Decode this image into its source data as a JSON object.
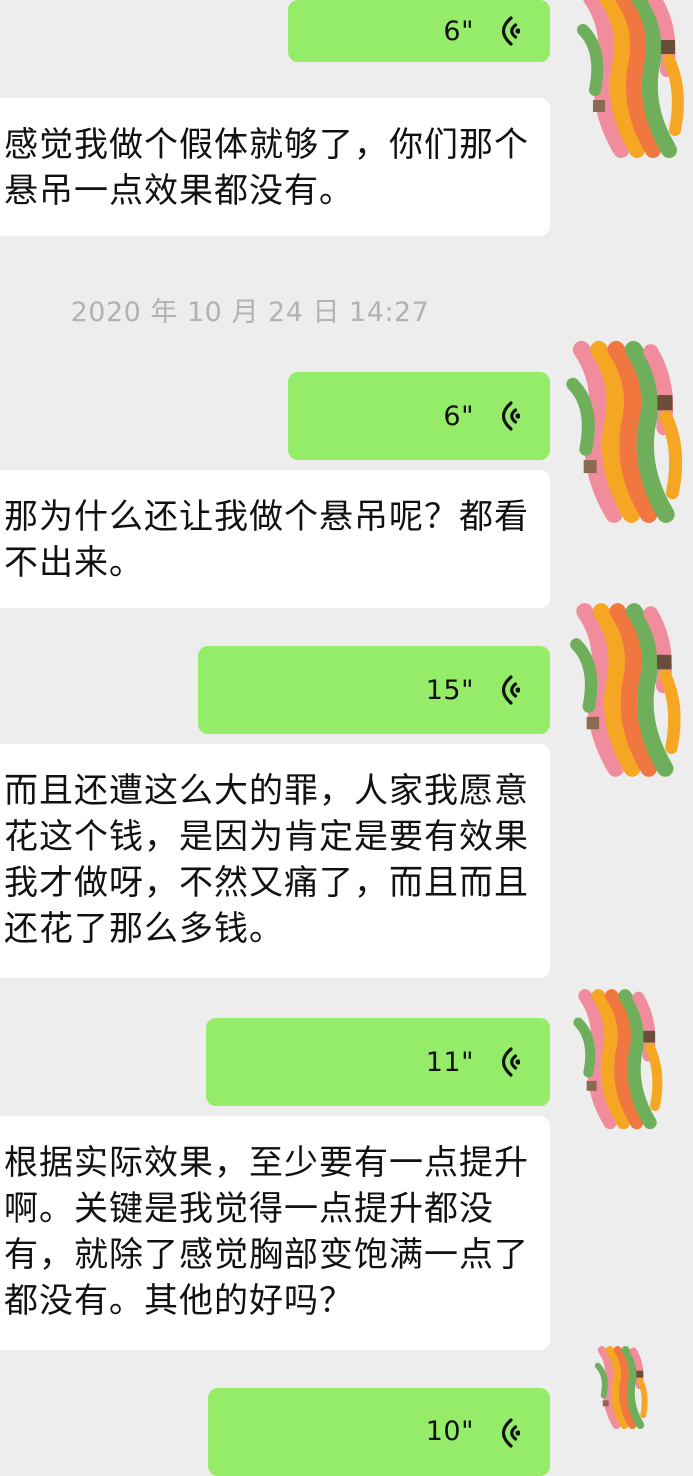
{
  "chat": {
    "timestamp": "2020 年 10 月 24 日 14:27",
    "messages": [
      {
        "type": "voice",
        "side": "right",
        "duration": "6\""
      },
      {
        "type": "text",
        "side": "left",
        "text": "感觉我做个假体就够了，你们那个悬吊一点效果都没有。"
      },
      {
        "type": "voice",
        "side": "right",
        "duration": "6\""
      },
      {
        "type": "text",
        "side": "left",
        "text": "那为什么还让我做个悬吊呢？都看不出来。"
      },
      {
        "type": "voice",
        "side": "right",
        "duration": "15\""
      },
      {
        "type": "text",
        "side": "left",
        "text": "而且还遭这么大的罪，人家我愿意花这个钱，是因为肯定是要有效果我才做呀，不然又痛了，而且而且还花了那么多钱。"
      },
      {
        "type": "voice",
        "side": "right",
        "duration": "11\""
      },
      {
        "type": "text",
        "side": "left",
        "text": "根据实际效果，至少要有一点提升啊。关键是我觉得一点提升都没有，就除了感觉胸部变饱满一点了都没有。其他的好吗？"
      },
      {
        "type": "voice",
        "side": "right",
        "duration": "10\""
      }
    ]
  },
  "colors": {
    "background": "#ededed",
    "voice_bubble": "#95ec69",
    "text_bubble": "#ffffff",
    "timestamp_text": "#b2b2b2"
  },
  "icons": [
    "voice-wave-icon",
    "user-avatar-mosaic"
  ]
}
